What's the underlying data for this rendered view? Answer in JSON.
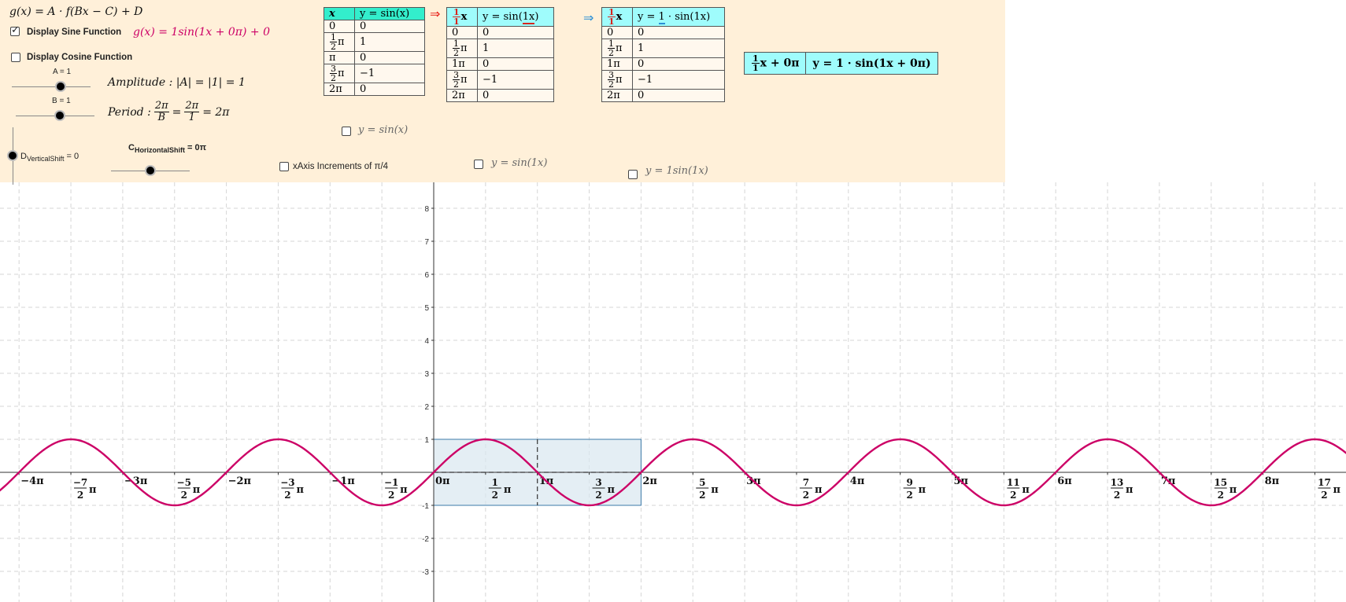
{
  "panel": {
    "general_formula": "g(x) = A · f(Bx − C) + D",
    "sine_checkbox": {
      "label": "Display Sine Function",
      "checked": true
    },
    "sine_formula": "g(x) = 1sin(1x + 0π) + 0",
    "cosine_checkbox": {
      "label": "Display Cosine Function",
      "checked": false
    },
    "slider_a_label": "A = 1",
    "amplitude_text": "Amplitude : |A| = |1| = 1",
    "slider_b_label": "B = 1",
    "period_prefix": "Period :",
    "period_num1": "2π",
    "period_den1": "B",
    "period_num2": "2π",
    "period_den2": "1",
    "period_result": "= 2π",
    "slider_d_label": "D",
    "slider_d_sub": "VerticalShift",
    "slider_d_value": " = 0",
    "slider_c_label": "C",
    "slider_c_sub": "HorizontalShift",
    "slider_c_value": " = 0π",
    "xaxis_checkbox": {
      "label": "xAxis Increments of π/4",
      "checked": false
    }
  },
  "table1": {
    "header_x": "x",
    "header_y": "y = sin(x)",
    "rows": [
      {
        "x": "0",
        "y": "0"
      },
      {
        "x_num": "1",
        "x_den": "2",
        "x_suffix": "π",
        "y": "1"
      },
      {
        "x": "π",
        "y": "0"
      },
      {
        "x_num": "3",
        "x_den": "2",
        "x_suffix": "π",
        "y": "−1"
      },
      {
        "x": "2π",
        "y": "0"
      }
    ],
    "checkbox_label": "y = sin(x)"
  },
  "arrow1": "⇒",
  "table2": {
    "header_x_num": "1",
    "header_x_den": "1",
    "header_x_var": "x",
    "header_y_prefix": "y = sin(",
    "header_y_inner": "1x",
    "header_y_suffix": ")",
    "rows": [
      {
        "x": "0",
        "y": "0"
      },
      {
        "x_num": "1",
        "x_den": "2",
        "x_suffix": "π",
        "y": "1"
      },
      {
        "x": "1π",
        "y": "0"
      },
      {
        "x_num": "3",
        "x_den": "2",
        "x_suffix": "π",
        "y": "−1"
      },
      {
        "x": "2π",
        "y": "0"
      }
    ],
    "checkbox_label": "y = sin(1x)"
  },
  "arrow2": "⇒",
  "table3": {
    "header_x_num": "1",
    "header_x_den": "1",
    "header_x_var": "x",
    "header_y_prefix": "y = ",
    "header_y_inner": "1",
    "header_y_suffix": " · sin(1x)",
    "rows": [
      {
        "x": "0",
        "y": "0"
      },
      {
        "x_num": "1",
        "x_den": "2",
        "x_suffix": "π",
        "y": "1"
      },
      {
        "x": "1π",
        "y": "0"
      },
      {
        "x_num": "3",
        "x_den": "2",
        "x_suffix": "π",
        "y": "−1"
      },
      {
        "x": "2π",
        "y": "0"
      }
    ],
    "checkbox_label": "y = 1sin(1x)"
  },
  "transform_box": {
    "x_num": "1",
    "x_den": "1",
    "x_text": "x + 0π",
    "y_text": "y = 1 · sin(1x + 0π)"
  },
  "colors": {
    "panel_bg": "#fff0d9",
    "curve": "#cc0066",
    "box_fill": "#d9e7f0",
    "box_stroke": "#3b79a8",
    "table_header": "#9ffcfc",
    "header_green": "#33eecc",
    "arrow_red": "#e8261e",
    "arrow_blue": "#2b8fd6"
  },
  "graph": {
    "x_range_pi": [
      -4.15,
      8.8
    ],
    "y_range": [
      -3.9,
      8.4
    ],
    "y_ticks": [
      "-3",
      "-2",
      "-1",
      "1",
      "2",
      "3",
      "4",
      "5",
      "6",
      "7",
      "8"
    ],
    "x_tick_labels": [
      {
        "v": -4,
        "t": "−4π"
      },
      {
        "v": -3.5,
        "n": "−7",
        "d": "2"
      },
      {
        "v": -3,
        "t": "−3π"
      },
      {
        "v": -2.5,
        "n": "−5",
        "d": "2"
      },
      {
        "v": -2,
        "t": "−2π"
      },
      {
        "v": -1.5,
        "n": "−3",
        "d": "2"
      },
      {
        "v": -1,
        "t": "−1π"
      },
      {
        "v": -0.5,
        "n": "−1",
        "d": "2"
      },
      {
        "v": 0,
        "t": "0π"
      },
      {
        "v": 0.5,
        "n": "1",
        "d": "2"
      },
      {
        "v": 1,
        "t": "1π"
      },
      {
        "v": 1.5,
        "n": "3",
        "d": "2"
      },
      {
        "v": 2,
        "t": "2π"
      },
      {
        "v": 2.5,
        "n": "5",
        "d": "2"
      },
      {
        "v": 3,
        "t": "3π"
      },
      {
        "v": 3.5,
        "n": "7",
        "d": "2"
      },
      {
        "v": 4,
        "t": "4π"
      },
      {
        "v": 4.5,
        "n": "9",
        "d": "2"
      },
      {
        "v": 5,
        "t": "5π"
      },
      {
        "v": 5.5,
        "n": "11",
        "d": "2"
      },
      {
        "v": 6,
        "t": "6π"
      },
      {
        "v": 6.5,
        "n": "13",
        "d": "2"
      },
      {
        "v": 7,
        "t": "7π"
      },
      {
        "v": 7.5,
        "n": "15",
        "d": "2"
      },
      {
        "v": 8,
        "t": "8π"
      },
      {
        "v": 8.5,
        "n": "17",
        "d": "2"
      }
    ],
    "function": {
      "A": 1,
      "B": 1,
      "C": 0,
      "D": 0
    },
    "period_box": {
      "x_from_pi": 0,
      "x_to_pi": 2,
      "y_from": -1,
      "y_to": 1
    }
  }
}
